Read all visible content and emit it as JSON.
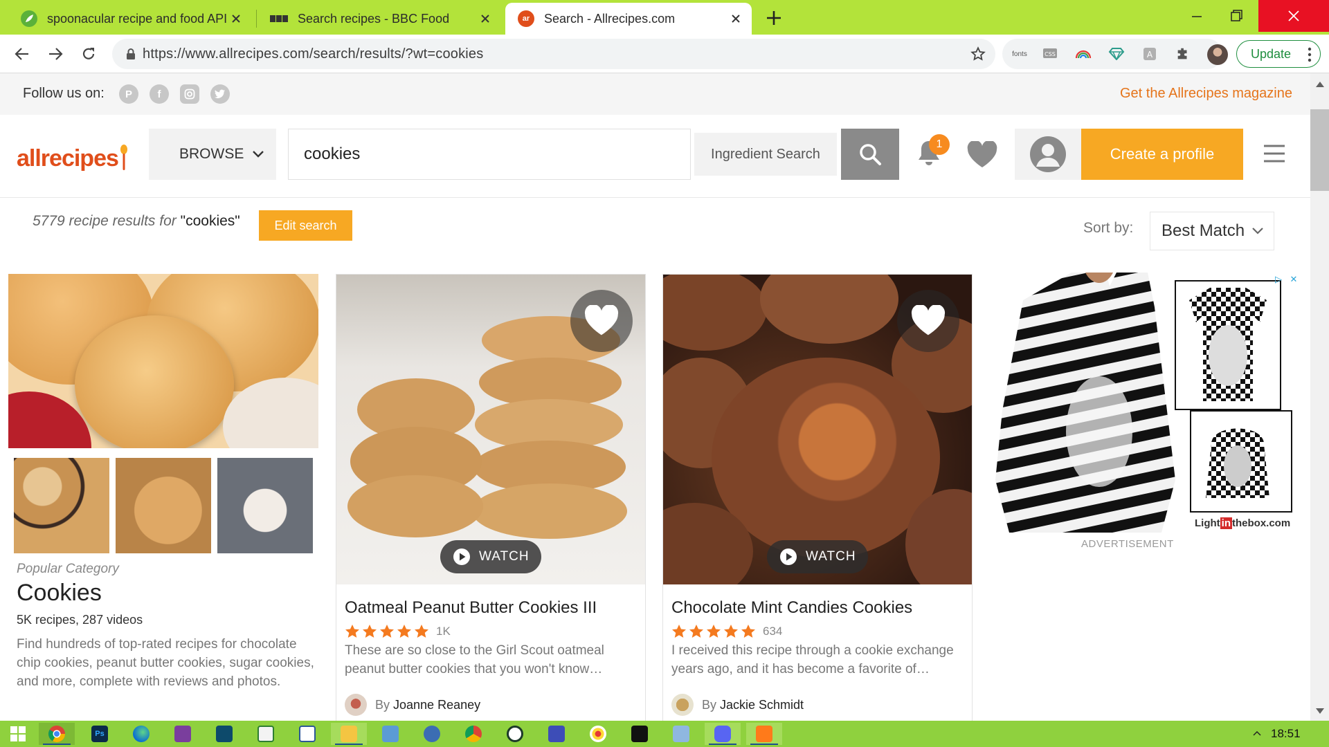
{
  "browser": {
    "tabs": [
      {
        "title": "spoonacular recipe and food API",
        "favicon": "spoonacular-icon",
        "active": false
      },
      {
        "title": "Search recipes - BBC Food",
        "favicon": "bbc-icon",
        "active": false
      },
      {
        "title": "Search - Allrecipes.com",
        "favicon": "allrecipes-icon",
        "active": true
      }
    ],
    "url": "https://www.allrecipes.com/search/results/?wt=cookies",
    "extension_fonts_label": "fonts",
    "extension_css_label": "CSS",
    "update_label": "Update",
    "tabbar_color": "#b3e33a"
  },
  "site": {
    "follow_label": "Follow us on:",
    "social": [
      "pinterest-icon",
      "facebook-icon",
      "instagram-icon",
      "twitter-icon"
    ],
    "magazine_link": "Get the Allrecipes magazine",
    "logo_text": "allrecipes",
    "browse_label": "BROWSE",
    "search_value": "cookies",
    "ingredient_search_label": "Ingredient Search",
    "notification_count": "1",
    "create_profile_label": "Create a profile",
    "accent_color": "#f7a823",
    "brand_color": "#e04e1b"
  },
  "results": {
    "count_text": "5779 recipe results for",
    "query_text": "\"cookies\"",
    "edit_search_label": "Edit search",
    "sort_label": "Sort by:",
    "sort_value": "Best Match"
  },
  "category": {
    "kicker": "Popular Category",
    "title": "Cookies",
    "counts": "5K recipes, 287 videos",
    "description": "Find hundreds of top-rated recipes for chocolate chip cookies, peanut butter cookies, sugar cookies, and more, complete with reviews and photos."
  },
  "recipes": [
    {
      "title": "Oatmeal Peanut Butter Cookies III",
      "rating_count": "1K",
      "stars": 5,
      "description": "These are so close to the Girl Scout oatmeal peanut butter cookies that you won't know…",
      "by_label": "By",
      "author": "Joanne Reaney",
      "watch_label": "WATCH"
    },
    {
      "title": "Chocolate Mint Candies Cookies",
      "rating_count": "634",
      "stars": 5,
      "description": "I received this recipe through a cookie exchange years ago, and it has become a favorite of…",
      "by_label": "By",
      "author": "Jackie Schmidt",
      "watch_label": "WATCH"
    }
  ],
  "ad": {
    "label": "ADVERTISEMENT",
    "brand_prefix": "Light",
    "brand_in": "in",
    "brand_suffix": "thebox.com"
  },
  "taskbar": {
    "clock": "18:51",
    "apps": [
      "start-icon",
      "chrome-icon",
      "photoshop-icon",
      "edge-icon",
      "onenote-icon",
      "notes-icon",
      "sheets-icon",
      "reader-icon",
      "explorer-icon",
      "control-panel-icon",
      "network-icon",
      "chrome-alt-icon",
      "whatsapp-icon",
      "settings-icon",
      "paint-icon",
      "terminal-icon",
      "files-icon",
      "discord-icon",
      "media-icon"
    ]
  }
}
